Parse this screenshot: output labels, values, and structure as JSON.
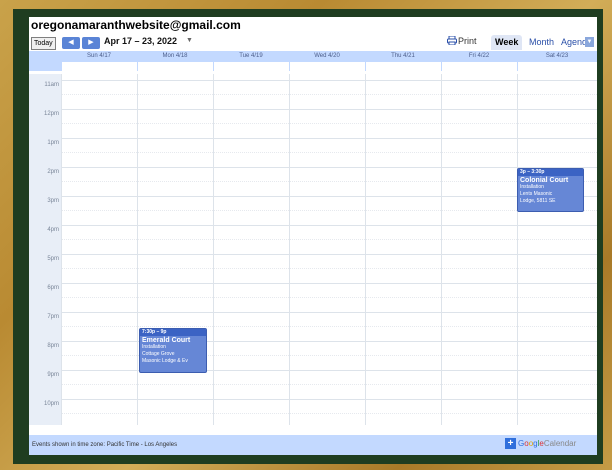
{
  "account": "oregonamaranthwebsite@gmail.com",
  "toolbar": {
    "today_label": "Today",
    "prev_label": "◀",
    "next_label": "▶",
    "date_range": "Apr 17 – 23, 2022",
    "range_dropdown": "▼",
    "print_label": "Print",
    "views": [
      "Week",
      "Month",
      "Agenda"
    ],
    "active_view": "Week",
    "view_dropdown": "▼"
  },
  "days": [
    "Sun 4/17",
    "Mon 4/18",
    "Tue 4/19",
    "Wed 4/20",
    "Thu 4/21",
    "Fri 4/22",
    "Sat 4/23"
  ],
  "hours": [
    "11am",
    "12pm",
    "1pm",
    "2pm",
    "3pm",
    "4pm",
    "5pm",
    "6pm",
    "7pm",
    "8pm",
    "9pm",
    "10pm"
  ],
  "events": [
    {
      "time": "3p – 3:30p",
      "title": "Colonial Court",
      "lines": [
        "Installation",
        "Lents Masonic",
        "Lodge, 5811 SE"
      ],
      "color": "#6687d6"
    },
    {
      "time": "7:30p – 9p",
      "title": "Emerald Court",
      "lines": [
        "Installation",
        "Cottage Grove",
        "Masonic Lodge & Ev"
      ],
      "color": "#6687d6"
    }
  ],
  "footer": {
    "timezone_text": "Events shown in time zone: Pacific Time - Los Angeles",
    "google_letters": [
      "G",
      "o",
      "o",
      "g",
      "l",
      "e"
    ],
    "calendar_label": "Calendar",
    "add_icon": "+"
  },
  "colors": {
    "frame": "#1f3d20",
    "header_bg": "#c3d9ff",
    "event_bg": "#6687d6",
    "event_header": "#3b63c4"
  }
}
